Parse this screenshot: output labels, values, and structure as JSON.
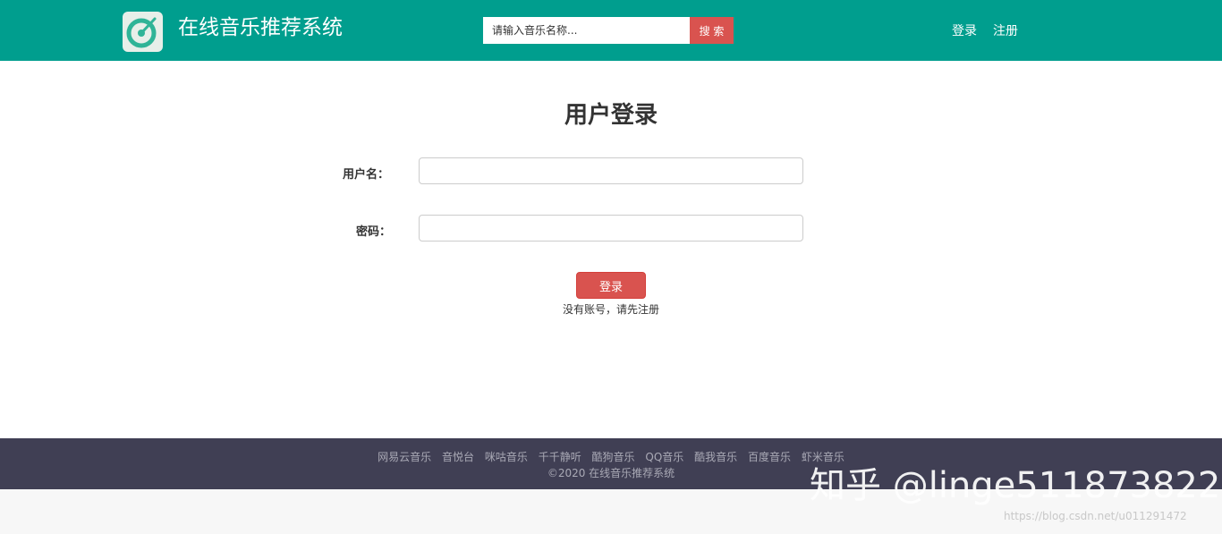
{
  "header": {
    "logo_icon": "music-disc-icon",
    "site_title": "在线音乐推荐系统",
    "search_placeholder": "请输入音乐名称...",
    "search_button": "搜 索",
    "login_link": "登录",
    "register_link": "注册",
    "bg_color": "#009e8e",
    "accent_color": "#d9534f"
  },
  "main": {
    "title": "用户登录",
    "username_label": "用户名：",
    "username_value": "",
    "password_label": "密码：",
    "password_value": "",
    "login_button": "登录",
    "register_hint": "没有账号，请先注册"
  },
  "footer": {
    "links": [
      "网易云音乐",
      "音悦台",
      "咪咕音乐",
      "千千静听",
      "酷狗音乐",
      "QQ音乐",
      "酷我音乐",
      "百度音乐",
      "虾米音乐"
    ],
    "copyright": "©2020 在线音乐推荐系统",
    "bg_color": "#403f54"
  },
  "watermarks": {
    "zhihu": "知乎 @linge511873822",
    "url": "https://blog.csdn.net/u011291472"
  }
}
